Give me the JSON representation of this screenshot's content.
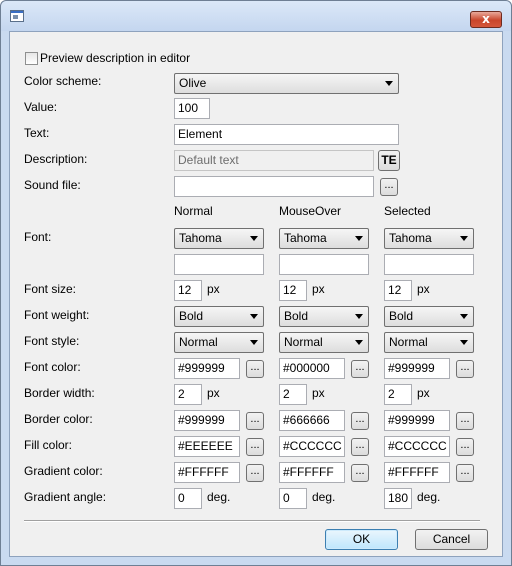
{
  "window": {
    "close_glyph": "x"
  },
  "preview_label": "Preview description in editor",
  "labels": {
    "color_scheme": "Color scheme:",
    "value": "Value:",
    "text": "Text:",
    "description": "Description:",
    "sound_file": "Sound file:",
    "font": "Font:",
    "font_size": "Font size:",
    "font_weight": "Font weight:",
    "font_style": "Font style:",
    "font_color": "Font color:",
    "border_width": "Border width:",
    "border_color": "Border color:",
    "fill_color": "Fill color:",
    "gradient_color": "Gradient color:",
    "gradient_angle": "Gradient angle:"
  },
  "fields": {
    "color_scheme": "Olive",
    "value": "100",
    "text": "Element",
    "description": "Default text",
    "sound_file": ""
  },
  "buttons": {
    "te": "TE",
    "browse": "...",
    "ok": "OK",
    "cancel": "Cancel"
  },
  "units": {
    "px": "px",
    "deg": "deg."
  },
  "columns": [
    {
      "header": "Normal",
      "font": "Tahoma",
      "font_extra": "",
      "font_size": "12",
      "font_weight": "Bold",
      "font_style": "Normal",
      "font_color": "#999999",
      "border_width": "2",
      "border_color": "#999999",
      "fill_color": "#EEEEEE",
      "gradient_color": "#FFFFFF",
      "gradient_angle": "0"
    },
    {
      "header": "MouseOver",
      "font": "Tahoma",
      "font_extra": "",
      "font_size": "12",
      "font_weight": "Bold",
      "font_style": "Normal",
      "font_color": "#000000",
      "border_width": "2",
      "border_color": "#666666",
      "fill_color": "#CCCCCC",
      "gradient_color": "#FFFFFF",
      "gradient_angle": "0"
    },
    {
      "header": "Selected",
      "font": "Tahoma",
      "font_extra": "",
      "font_size": "12",
      "font_weight": "Bold",
      "font_style": "Normal",
      "font_color": "#999999",
      "border_width": "2",
      "border_color": "#999999",
      "fill_color": "#CCCCCC",
      "gradient_color": "#FFFFFF",
      "gradient_angle": "180"
    }
  ]
}
